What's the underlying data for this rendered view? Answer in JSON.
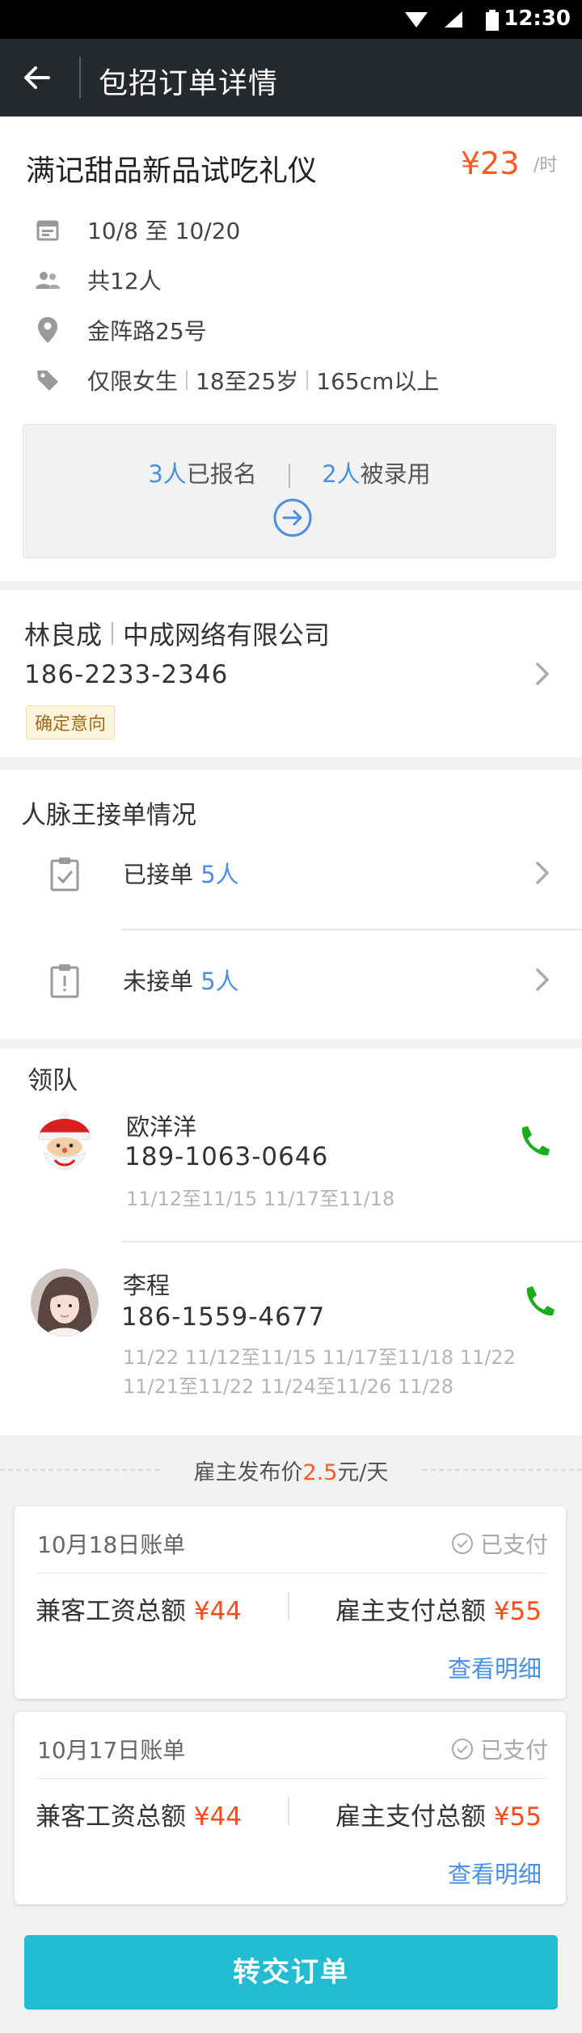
{
  "status_bar": {
    "time": "12:30"
  },
  "header": {
    "title": "包招订单详情"
  },
  "job": {
    "title": "满记甜品新品试吃礼仪",
    "price": "¥23",
    "price_unit": "/时",
    "dates": "10/8 至 10/20",
    "headcount": "共12人",
    "address": "金阵路25号",
    "requirements": [
      "仅限女生",
      "18至25岁",
      "165cm以上"
    ],
    "enrolled_count": "3人",
    "enrolled_label": "已报名",
    "hired_count": "2人",
    "hired_label": "被录用"
  },
  "employer": {
    "name": "林良成",
    "company": "中成网络有限公司",
    "phone": "186-2233-2346",
    "tag": "确定意向"
  },
  "acceptance": {
    "heading": "人脉王接单情况",
    "accepted_label": "已接单",
    "accepted_count": "5人",
    "pending_label": "未接单",
    "pending_count": "5人"
  },
  "leaders": {
    "heading": "领队",
    "people": [
      {
        "name": "欧洋洋",
        "phone": "189-1063-0646",
        "dates_line1": "11/12至11/15   11/17至11/18",
        "dates_line2": ""
      },
      {
        "name": "李程",
        "phone": "186-1559-4677",
        "dates_line1": "11/22   11/12至11/15   11/17至11/18   11/22",
        "dates_line2": "11/21至11/22   11/24至11/26   11/28"
      }
    ]
  },
  "employer_price": {
    "prefix": "雇主发布价",
    "value": "2.5",
    "suffix": "元/天"
  },
  "bills": [
    {
      "date": "10月18日账单",
      "status": "已支付",
      "wage_label": "兼客工资总额",
      "wage": "¥44",
      "pay_label": "雇主支付总额",
      "pay": "¥55",
      "detail": "查看明细"
    },
    {
      "date": "10月17日账单",
      "status": "已支付",
      "wage_label": "兼客工资总额",
      "wage": "¥44",
      "pay_label": "雇主支付总额",
      "pay": "¥55",
      "detail": "查看明细"
    }
  ],
  "actions": {
    "submit": "转交订单"
  },
  "colors": {
    "accent_blue": "#4a90e2",
    "price_orange": "#ff5a1f",
    "call_green": "#1aad19",
    "submit_teal": "#22bcd2",
    "appbar": "#25292d"
  }
}
